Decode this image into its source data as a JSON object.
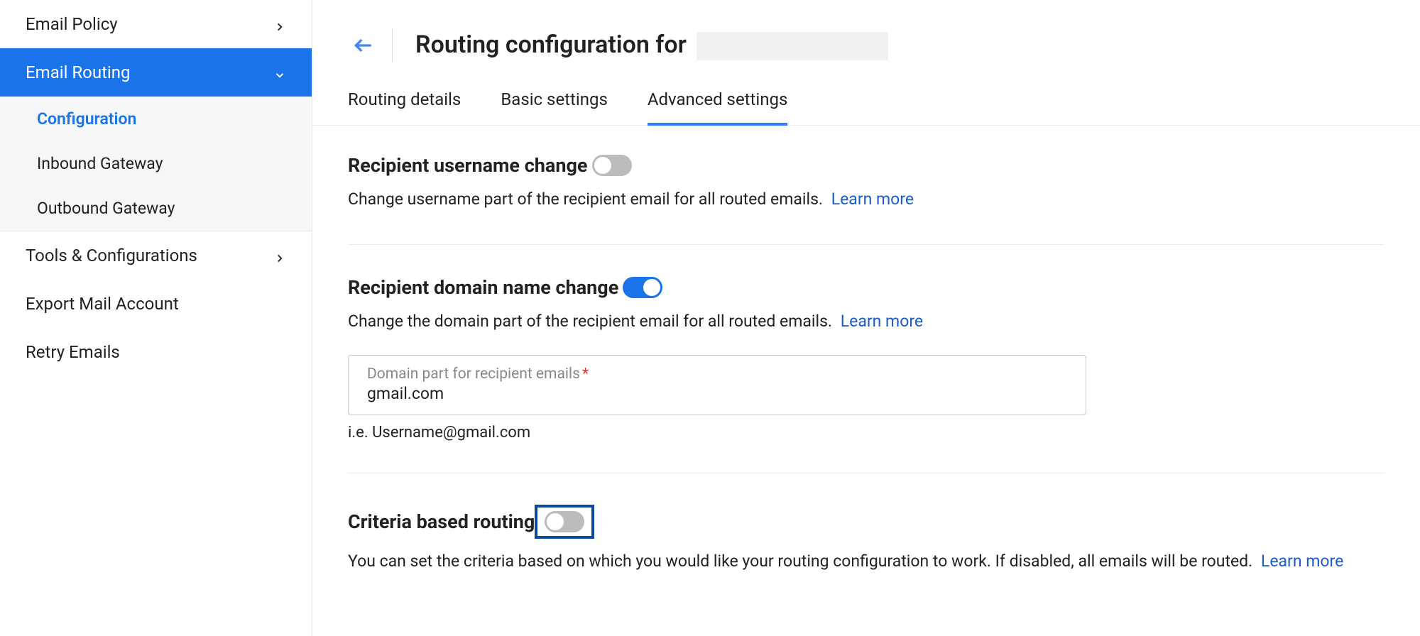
{
  "sidebar": {
    "items": [
      {
        "label": "Email Policy",
        "arrow": "right"
      },
      {
        "label": "Email Routing",
        "arrow": "down",
        "active": true
      },
      {
        "label": "Tools & Configurations",
        "arrow": "right"
      },
      {
        "label": "Export Mail Account"
      },
      {
        "label": "Retry Emails"
      }
    ],
    "subitems": [
      {
        "label": "Configuration",
        "selected": true
      },
      {
        "label": "Inbound Gateway"
      },
      {
        "label": "Outbound Gateway"
      }
    ]
  },
  "header": {
    "title": "Routing configuration for"
  },
  "tabs": [
    {
      "label": "Routing details"
    },
    {
      "label": "Basic settings"
    },
    {
      "label": "Advanced settings",
      "active": true
    }
  ],
  "sections": {
    "username": {
      "title": "Recipient username change",
      "toggle": false,
      "desc": "Change username part of the recipient email for all routed emails.",
      "learn": "Learn more"
    },
    "domain": {
      "title": "Recipient domain name change",
      "toggle": true,
      "desc": "Change the domain part of the recipient email for all routed emails.",
      "learn": "Learn more",
      "input_label": "Domain part for recipient emails",
      "input_value": "gmail.com",
      "hint": "i.e. Username@gmail.com"
    },
    "criteria": {
      "title": "Criteria based routing",
      "toggle": false,
      "highlighted": true,
      "desc": "You can set the criteria based on which you would like your routing configuration to work. If disabled, all emails will be routed.",
      "learn": "Learn more"
    }
  }
}
